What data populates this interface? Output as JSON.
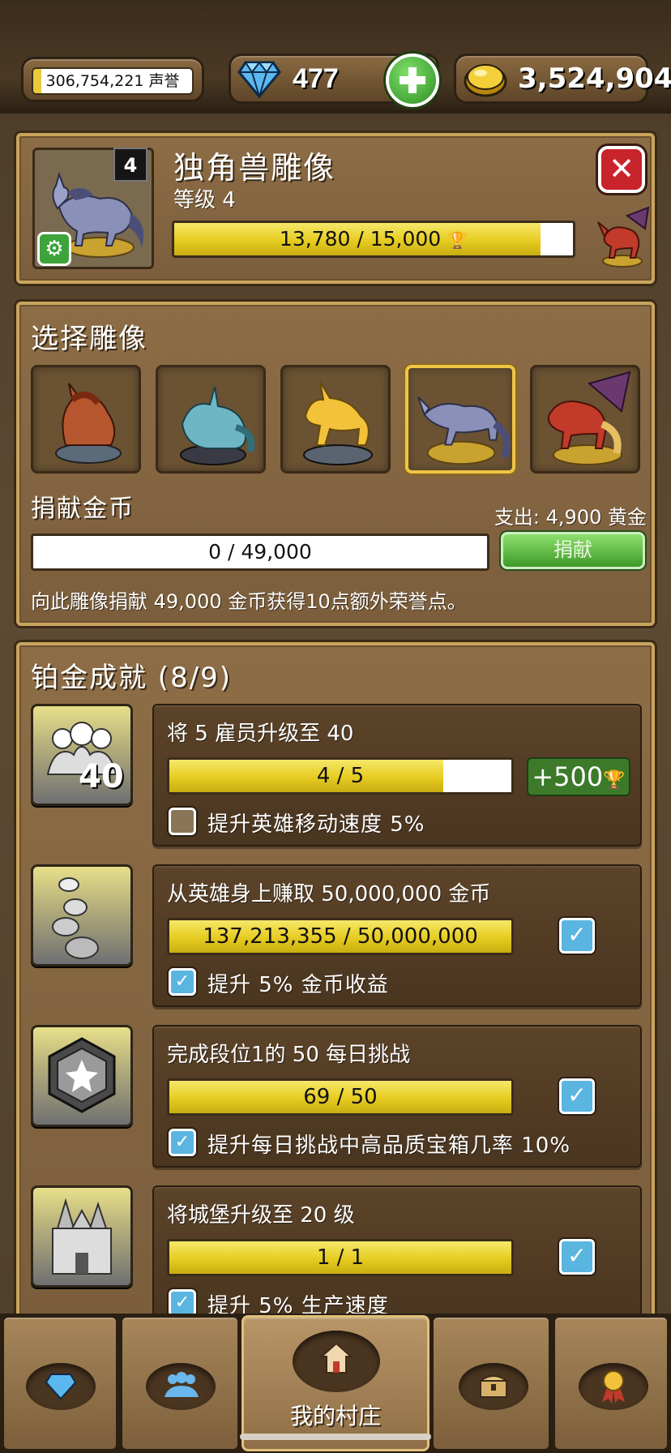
{
  "topbar": {
    "reputation_text": "306,754,221 声誉",
    "gems": "477",
    "gold": "3,524,904"
  },
  "statue": {
    "title": "独角兽雕像",
    "level_label": "等级 4",
    "level_badge": "4",
    "progress_text": "13,780 / 15,000",
    "progress_fraction": 0.919,
    "trophy_glyph": "🏆"
  },
  "select": {
    "title": "选择雕像",
    "statues": [
      "bronze-unicorn",
      "teal-unicorn",
      "gold-unicorn",
      "silver-unicorn",
      "winged-red-unicorn"
    ],
    "selected_index": 3,
    "donate_label": "捐献金币",
    "cost_text": "支出: 4,900 黄金",
    "donate_progress": "0 / 49,000",
    "donate_fraction": 0,
    "donate_button": "捐献",
    "description": "向此雕像捐献 49,000 金币获得10点额外荣誉点。"
  },
  "achievements": {
    "title": "铂金成就 (8/9)",
    "items": [
      {
        "title": "将 5 雇员升级至 40",
        "progress": "4 / 5",
        "fraction": 0.8,
        "reward": "+500",
        "bonus": "提升英雄移动速度 5%",
        "done": false,
        "icon": "employees-icon",
        "icon_text": "40"
      },
      {
        "title": "从英雄身上赚取 50,000,000 金币",
        "progress": "137,213,355 / 50,000,000",
        "fraction": 1,
        "bonus": "提升 5% 金币收益",
        "done": true,
        "icon": "coins-icon"
      },
      {
        "title": "完成段位1的 50 每日挑战",
        "progress": "69 / 50",
        "fraction": 1,
        "bonus": "提升每日挑战中高品质宝箱几率 10%",
        "done": true,
        "icon": "challenge-badge-icon"
      },
      {
        "title": "将城堡升级至 20 级",
        "progress": "1 / 1",
        "fraction": 1,
        "bonus": "提升 5% 生产速度",
        "done": true,
        "icon": "castle-icon"
      }
    ]
  },
  "nav": {
    "tabs": [
      {
        "name": "gems-tab",
        "icon": "gem-icon"
      },
      {
        "name": "heroes-tab",
        "icon": "people-icon"
      },
      {
        "name": "village-tab",
        "icon": "house-icon",
        "label": "我的村庄"
      },
      {
        "name": "chest-tab",
        "icon": "chest-icon"
      },
      {
        "name": "awards-tab",
        "icon": "medal-icon"
      }
    ]
  },
  "colors": {
    "accent_gold": "#e6cc20",
    "panel": "#7b5e3c",
    "frame": "#c9a45c",
    "check": "#5ab5e0",
    "close": "#c9232b"
  }
}
